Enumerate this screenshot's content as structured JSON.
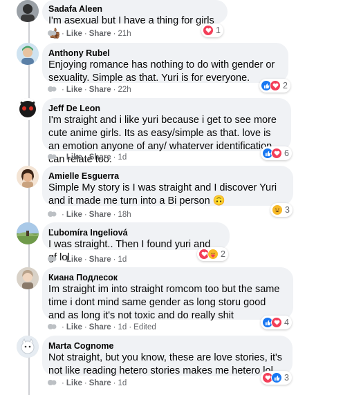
{
  "comments": [
    {
      "name": "Sadafa Aleen",
      "text": "I'm asexual but I have a thing for girls 👍🏾",
      "like": "Like",
      "share": "Share",
      "time": "21h",
      "edited": "",
      "reaction_count": "1",
      "reactions": [
        "love"
      ]
    },
    {
      "name": "Anthony Rubel",
      "text": "Enjoying romance has nothing to do with gender or sexuality. Simple as that. Yuri is for everyone.",
      "like": "Like",
      "share": "Share",
      "time": "22h",
      "edited": "",
      "reaction_count": "2",
      "reactions": [
        "like",
        "love"
      ]
    },
    {
      "name": "Jeff De Leon",
      "text": "I'm straight and i like yuri because i get to see more cute anime girls. Its as easy/simple as that. love is an emotion anyone of any/ whaterver identification can relate too.",
      "like": "Like",
      "share": "Share",
      "time": "1d",
      "edited": "",
      "reaction_count": "6",
      "reactions": [
        "like",
        "love"
      ]
    },
    {
      "name": "Amielle Esguerra",
      "text": "Simple My story is I was straight and I discover Yuri and it made me turn into a Bi person 🙃",
      "like": "Like",
      "share": "Share",
      "time": "18h",
      "edited": "",
      "reaction_count": "3",
      "reactions": [
        "haha"
      ]
    },
    {
      "name": "Ľubomíra Ingeliová",
      "text": "I was straight.. Then I found yuri and gf lol",
      "like": "Like",
      "share": "Share",
      "time": "1d",
      "edited": "",
      "reaction_count": "2",
      "reactions": [
        "love",
        "care"
      ]
    },
    {
      "name": "Киана Подлесок",
      "text": "Im straight im into straight romcom too but the same time i dont mind same gender as long storu good and as long it's not toxic and do really shit",
      "like": "Like",
      "share": "Share",
      "time": "1d",
      "edited": "Edited",
      "reaction_count": "4",
      "reactions": [
        "like",
        "love"
      ]
    },
    {
      "name": "Marta Cognome",
      "text": "Not straight, but you know, these are love stories, it's not like reading hetero stories makes me hetero lol",
      "like": "Like",
      "share": "Share",
      "time": "1d",
      "edited": "",
      "reaction_count": "3",
      "reactions": [
        "love",
        "like"
      ]
    }
  ],
  "colors": {
    "bubble": "#f0f2f5",
    "meta": "#65676b",
    "like_blue": "#1877f2",
    "love_red": "#f33e58",
    "haha_yellow": "#f7b928"
  }
}
